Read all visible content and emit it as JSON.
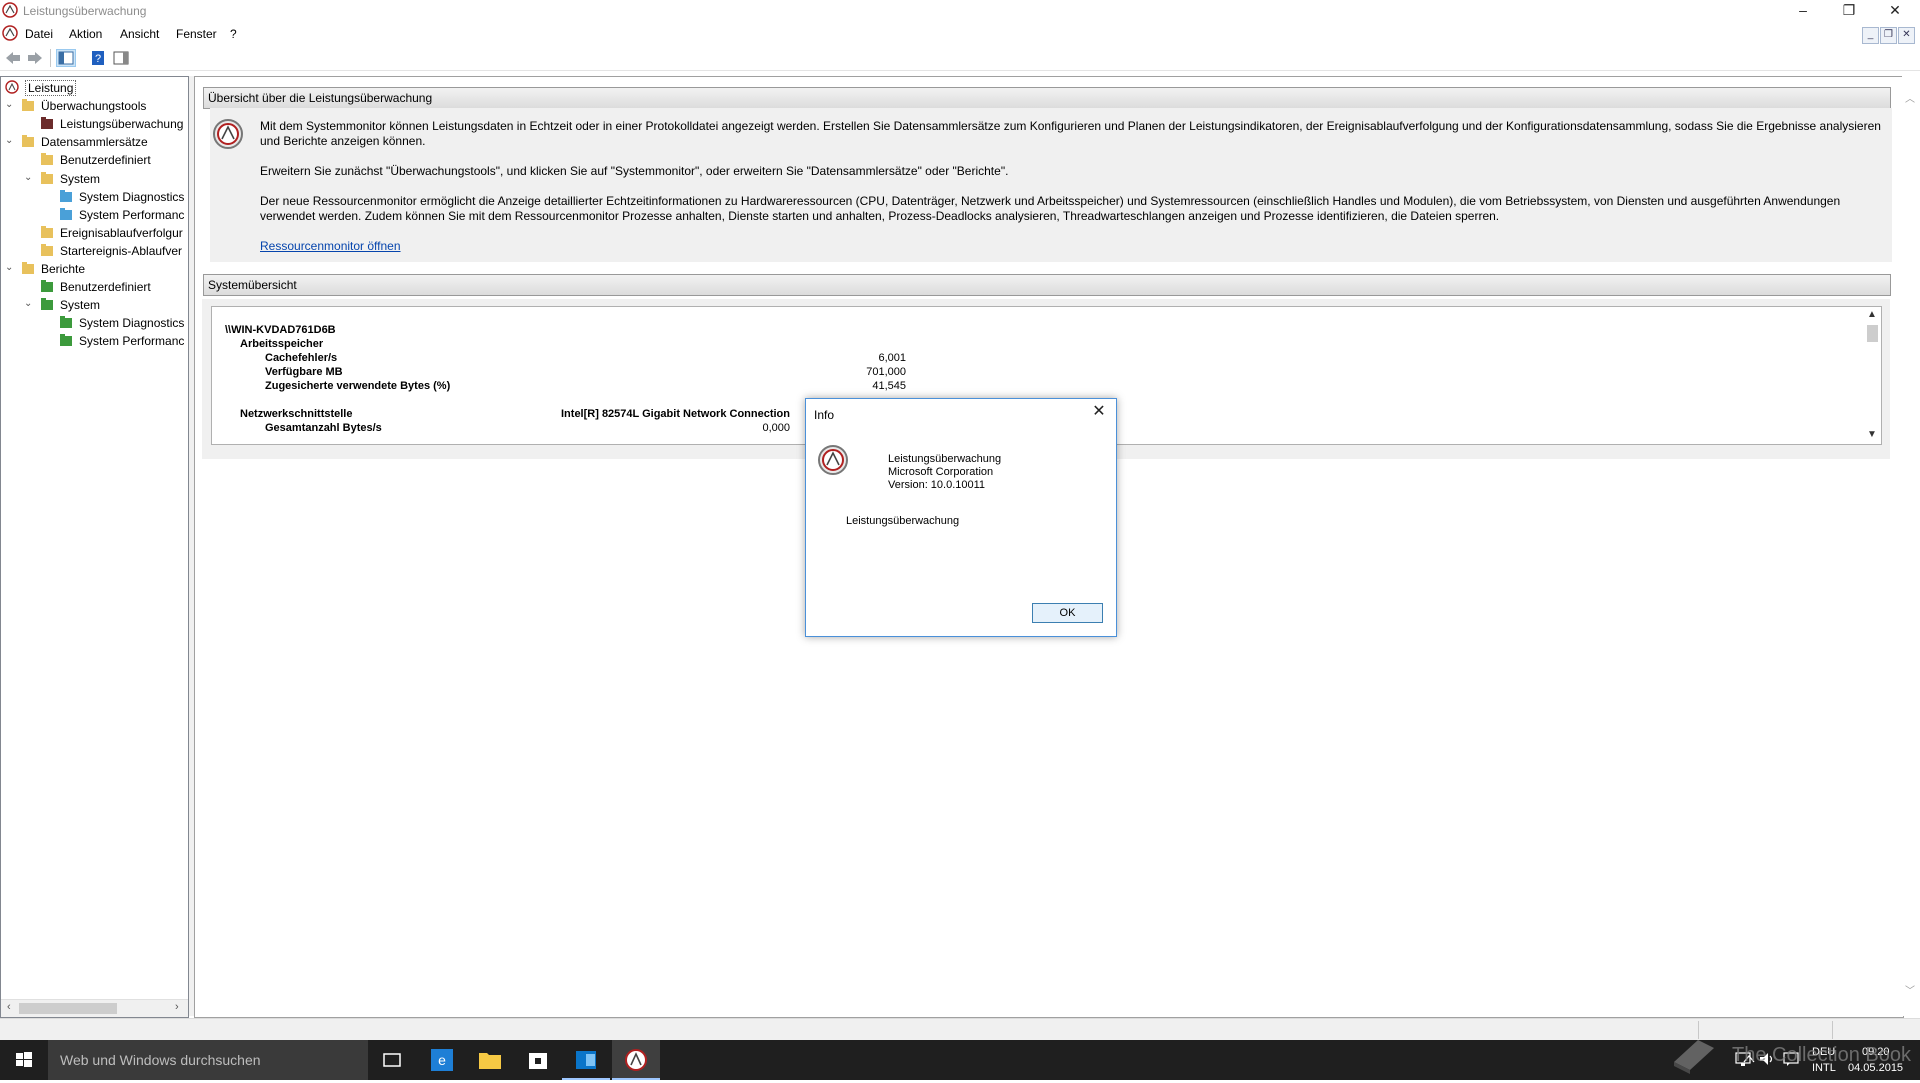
{
  "window": {
    "title": "Leistungsüberwachung",
    "controls": {
      "minimize": "–",
      "restore": "❐",
      "close": "✕"
    }
  },
  "menu": {
    "items": [
      "Datei",
      "Aktion",
      "Ansicht",
      "Fenster",
      "?"
    ],
    "mdi_controls": {
      "minimize": "_",
      "restore": "❐",
      "close": "✕"
    }
  },
  "toolbar": {
    "icons": [
      "back-arrow-icon",
      "forward-arrow-icon",
      "show-hide-console-tree-icon",
      "help-icon",
      "show-hide-action-pane-icon"
    ]
  },
  "tree": {
    "items": [
      {
        "label": "Leistung",
        "level": 0,
        "expander": "",
        "icon": "perfmon-icon"
      },
      {
        "label": "Überwachungstools",
        "level": 0,
        "expander": "v",
        "icon": "folder-tools-icon"
      },
      {
        "label": "Leistungsüberwachung",
        "level": 1,
        "expander": "",
        "icon": "graph-icon"
      },
      {
        "label": "Datensammlersätze",
        "level": 0,
        "expander": "v",
        "icon": "folder-icon"
      },
      {
        "label": "Benutzerdefiniert",
        "level": 1,
        "expander": "",
        "icon": "folder-user-icon"
      },
      {
        "label": "System",
        "level": 1,
        "expander": "v",
        "icon": "folder-system-icon"
      },
      {
        "label": "System Diagnostics",
        "level": 2,
        "expander": "",
        "icon": "collector-set-icon"
      },
      {
        "label": "System Performanc",
        "level": 2,
        "expander": "",
        "icon": "collector-set-icon"
      },
      {
        "label": "Ereignisablaufverfolgur",
        "level": 1,
        "expander": "",
        "icon": "folder-icon"
      },
      {
        "label": "Startereignis-Ablaufver",
        "level": 1,
        "expander": "",
        "icon": "folder-icon"
      },
      {
        "label": "Berichte",
        "level": 0,
        "expander": "v",
        "icon": "folder-reports-icon"
      },
      {
        "label": "Benutzerdefiniert",
        "level": 1,
        "expander": "",
        "icon": "report-user-icon"
      },
      {
        "label": "System",
        "level": 1,
        "expander": "v",
        "icon": "report-system-icon"
      },
      {
        "label": "System Diagnostics",
        "level": 2,
        "expander": "",
        "icon": "report-icon"
      },
      {
        "label": "System Performanc",
        "level": 2,
        "expander": "",
        "icon": "report-icon"
      }
    ]
  },
  "overview": {
    "header": "Übersicht über die Leistungsüberwachung",
    "paragraph1": "Mit dem Systemmonitor können Leistungsdaten in Echtzeit oder in einer Protokolldatei angezeigt werden. Erstellen Sie Datensammlersätze zum Konfigurieren und Planen der Leistungsindikatoren, der Ereignisablaufverfolgung und der Konfigurationsdatensammlung, sodass Sie die Ergebnisse analysieren und Berichte anzeigen können.",
    "paragraph2": "Erweitern Sie zunächst \"Überwachungstools\", und klicken Sie auf \"Systemmonitor\", oder erweitern Sie \"Datensammlersätze\" oder \"Berichte\".",
    "paragraph3": "Der neue Ressourcenmonitor ermöglicht die Anzeige detaillierter Echtzeitinformationen zu Hardwareressourcen (CPU, Datenträger, Netzwerk und Arbeitsspeicher) und Systemressourcen (einschließlich Handles und Modulen), die vom Betriebssystem, von Diensten und ausgeführten Anwendungen verwendet werden. Zudem können Sie mit dem Ressourcenmonitor Prozesse anhalten, Dienste starten und anhalten, Prozess-Deadlocks analysieren, Threadwarteschlangen anzeigen und Prozesse identifizieren, die Dateien sperren.",
    "link": "Ressourcenmonitor öffnen"
  },
  "summary": {
    "header": "Systemübersicht",
    "machine": "\\\\WIN-KVDAD761D6B",
    "memory_group": "Arbeitsspeicher",
    "memory_counters": [
      {
        "name": "Cachefehler/s",
        "value": "6,001"
      },
      {
        "name": "Verfügbare MB",
        "value": "701,000"
      },
      {
        "name": "Zugesicherte verwendete Bytes (%)",
        "value": "41,545"
      }
    ],
    "network_group": "Netzwerkschnittstelle",
    "network_instance": "Intel[R] 82574L Gigabit Network Connection",
    "network_counters": [
      {
        "name": "Gesamtanzahl Bytes/s",
        "value": "0,000"
      }
    ]
  },
  "dialog": {
    "title": "Info",
    "product": "Leistungsüberwachung",
    "company": "Microsoft Corporation",
    "version": "Version: 10.0.10011",
    "description": "Leistungsüberwachung",
    "ok_label": "OK"
  },
  "taskbar": {
    "search_placeholder": "Web und Windows durchsuchen",
    "apps": [
      "task-view-icon",
      "internet-explorer-icon",
      "file-explorer-icon",
      "store-icon",
      "outlook-icon",
      "perfmon-icon"
    ],
    "active_app": "perfmon-icon",
    "language": "DEU",
    "keyboard": "INTL",
    "time": "09:20",
    "date": "04.05.2015"
  },
  "watermark": "The Collection Book"
}
